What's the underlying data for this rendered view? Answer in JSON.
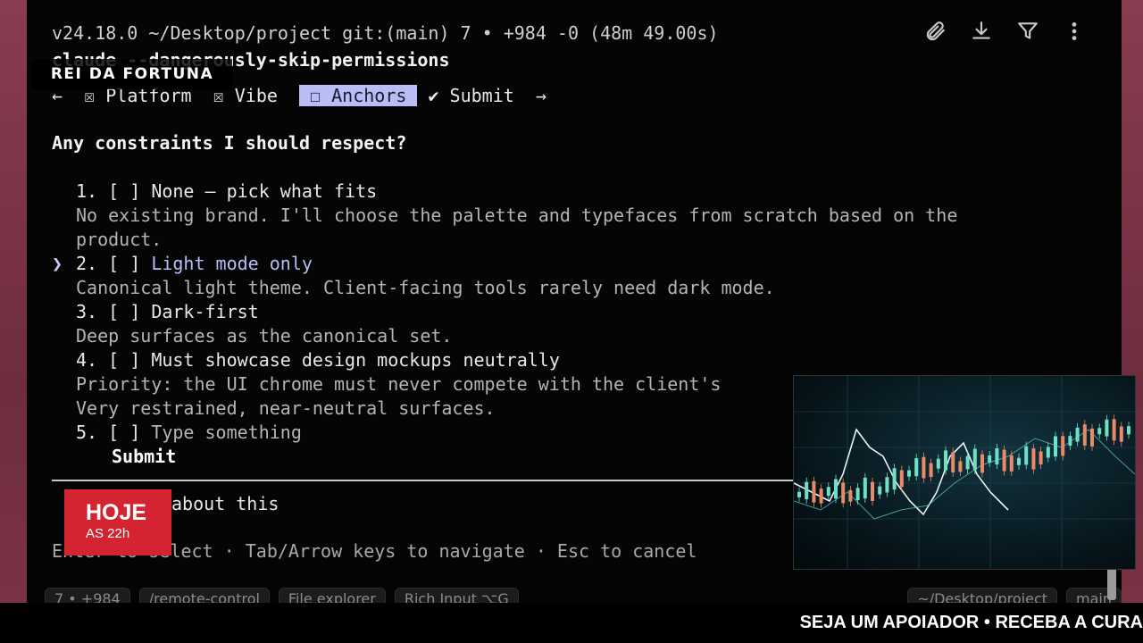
{
  "header": {
    "prompt_line": "v24.18.0 ~/Desktop/project git:(main) 7 • +984 -0 (48m 49.00s)",
    "command_line": "claude --dangerously-skip-permissions"
  },
  "tabs": {
    "prev_arrow": "←",
    "items": [
      {
        "mark": "☒",
        "label": "Platform"
      },
      {
        "mark": "☒",
        "label": "Vibe"
      },
      {
        "mark": "☐",
        "label": "Anchors"
      },
      {
        "mark": "✔",
        "label": "Submit"
      }
    ],
    "next_arrow": "→"
  },
  "question": "Any constraints I should respect?",
  "options": [
    {
      "num": "1.",
      "box": "[ ]",
      "label": "None — pick what fits",
      "desc": "No existing brand. I'll choose the palette and typefaces from scratch based on the",
      "desc2": "product."
    },
    {
      "num": "2.",
      "box": "[ ]",
      "label": "Light mode only",
      "desc": "Canonical light theme. Client-facing tools rarely need dark mode."
    },
    {
      "num": "3.",
      "box": "[ ]",
      "label": "Dark-first",
      "desc": "Deep surfaces as the canonical set."
    },
    {
      "num": "4.",
      "box": "[ ]",
      "label": "Must showcase design mockups neutrally",
      "desc": "Priority: the UI chrome must never compete with the client's",
      "desc2": "Very restrained, near-neutral surfaces."
    },
    {
      "num": "5.",
      "box": "[ ]",
      "label": "Type something"
    }
  ],
  "selector": "❯",
  "submit_label": "Submit",
  "chat_about": "about this",
  "hint": "Enter to select · Tab/Arrow keys to navigate · Esc to cancel",
  "statusbar": {
    "chips": [
      "7 • +984",
      "/remote-control",
      "File explorer",
      "Rich Input  ⌥G"
    ],
    "right_chips": [
      "~/Desktop/project",
      "main"
    ]
  },
  "overlay": {
    "channel": "REI DA FORTUNA",
    "hoje_big": "HOJE",
    "hoje_small": "AS 22h",
    "ticker": "SEJA UM APOIADOR • RECEBA A CURA"
  },
  "icons": [
    "paperclip-icon",
    "download-icon",
    "filter-icon",
    "more-vertical-icon"
  ],
  "colors": {
    "accent": "#b9bdf6",
    "background": "#050505",
    "badge_red": "#d42331"
  }
}
